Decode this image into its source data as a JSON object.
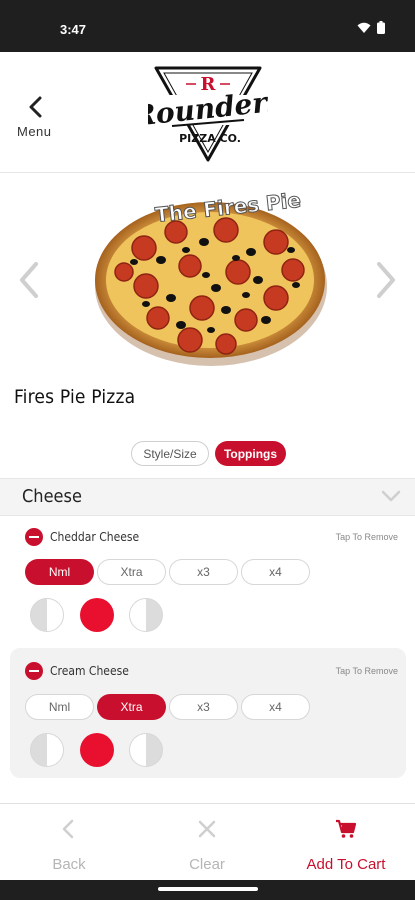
{
  "status_bar": {
    "time": "3:47"
  },
  "header": {
    "back_label": "Menu",
    "logo": {
      "badge_letter": "R",
      "script_text": "Rounders",
      "sub_text": "PIZZA CO."
    }
  },
  "hero": {
    "image_caption": "The Fires Pie"
  },
  "product": {
    "name": "Fires Pie Pizza"
  },
  "tabs": [
    {
      "label": "Style/Size",
      "active": false
    },
    {
      "label": "Toppings",
      "active": true
    }
  ],
  "section": {
    "title": "Cheese"
  },
  "toppings": [
    {
      "name": "Cheddar Cheese",
      "remove_hint": "Tap To Remove",
      "quantities": [
        "Nml",
        "Xtra",
        "x3",
        "x4"
      ],
      "selected_quantity": "Nml"
    },
    {
      "name": "Cream Cheese",
      "remove_hint": "Tap To Remove",
      "quantities": [
        "Nml",
        "Xtra",
        "x3",
        "x4"
      ],
      "selected_quantity": "Xtra"
    }
  ],
  "bottom_bar": {
    "back": "Back",
    "clear": "Clear",
    "add_to_cart": "Add To Cart"
  },
  "colors": {
    "accent": "#c8102e",
    "muted": "#b5b5b5"
  },
  "icons": [
    "wifi-icon",
    "battery-icon",
    "chevron-left-icon",
    "chevron-right-icon",
    "chevron-down-icon",
    "remove-icon",
    "close-icon",
    "cart-icon"
  ]
}
